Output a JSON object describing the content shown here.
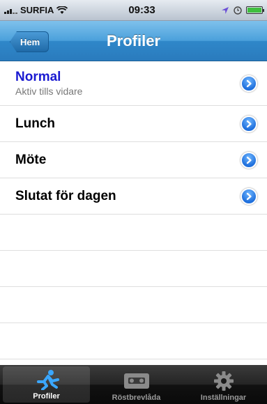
{
  "status_bar": {
    "carrier": "SURFIA",
    "time": "09:33",
    "battery_level": 1.0
  },
  "nav": {
    "back_label": "Hem",
    "title": "Profiler"
  },
  "profiles": [
    {
      "name": "Normal",
      "subtitle": "Aktiv tills vidare",
      "active": true
    },
    {
      "name": "Lunch"
    },
    {
      "name": "Möte"
    },
    {
      "name": "Slutat för dagen"
    }
  ],
  "tab_bar": {
    "tabs": [
      {
        "label": "Profiler",
        "icon": "running-person-icon",
        "selected": true
      },
      {
        "label": "Röstbrevlåda",
        "icon": "cassette-icon",
        "selected": false
      },
      {
        "label": "Inställningar",
        "icon": "gear-icon",
        "selected": false
      }
    ]
  },
  "colors": {
    "nav_bar": "#3b93d4",
    "active_profile": "#1a1ad1",
    "disclosure": "#1f6fdc",
    "tab_bar": "#1a1a1a",
    "battery": "#3fbf3f"
  }
}
